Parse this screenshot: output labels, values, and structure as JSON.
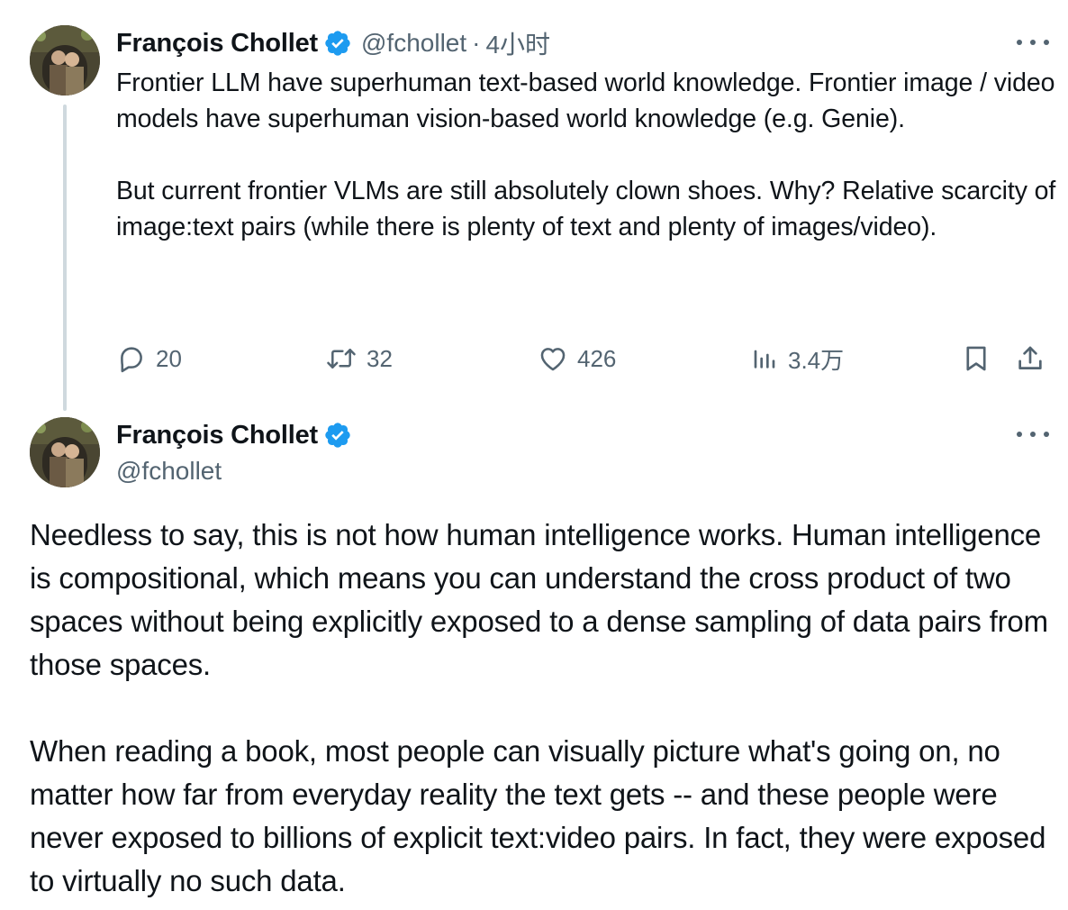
{
  "thread": {
    "parent_tweet": {
      "author_name": "François Chollet",
      "handle": "@fchollet",
      "separator": "·",
      "time": "4小时",
      "text": "Frontier LLM have superhuman text-based world knowledge. Frontier image / video models have superhuman vision-based world knowledge (e.g. Genie).\n\nBut current frontier VLMs are still absolutely clown shoes. Why? Relative scarcity of image:text pairs (while there is plenty of text and plenty of images/video).",
      "metrics": {
        "replies": "20",
        "retweets": "32",
        "likes": "426",
        "views": "3.4万"
      }
    },
    "main_tweet": {
      "author_name": "François Chollet",
      "handle": "@fchollet",
      "text": "Needless to say, this is not how human intelligence works. Human intelligence is compositional, which means you can understand the cross product of two spaces without being explicitly exposed to a dense sampling of data pairs from those spaces.\n\nWhen reading a book, most people can visually picture what's going on, no matter how far from everyday reality the text gets -- and these people were never exposed to billions of explicit text:video pairs. In fact, they were exposed to virtually no such data."
    }
  },
  "colors": {
    "text_primary": "#0f1419",
    "text_secondary": "#536471",
    "verified_blue": "#1d9bf0",
    "thread_line": "#cfd9de"
  },
  "icons": {
    "verified": "verified-badge-icon",
    "more": "more-options-icon",
    "reply": "reply-icon",
    "retweet": "retweet-icon",
    "like": "heart-icon",
    "views": "views-bar-chart-icon",
    "bookmark": "bookmark-icon",
    "share": "share-icon"
  }
}
